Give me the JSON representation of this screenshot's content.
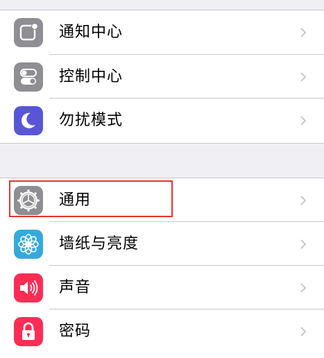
{
  "group_one": {
    "items": [
      {
        "label": "通知中心",
        "icon": "notification-center-icon",
        "icon_bg": "#8e8e93"
      },
      {
        "label": "控制中心",
        "icon": "control-center-icon",
        "icon_bg": "#8e8e93"
      },
      {
        "label": "勿扰模式",
        "icon": "moon-icon",
        "icon_bg": "#5856d6"
      }
    ]
  },
  "group_two": {
    "items": [
      {
        "label": "通用",
        "icon": "gear-icon",
        "icon_bg": "#8e8e93",
        "highlighted": true
      },
      {
        "label": "墙纸与亮度",
        "icon": "wallpaper-flower-icon",
        "icon_bg": "#34aadc"
      },
      {
        "label": "声音",
        "icon": "speaker-icon",
        "icon_bg": "#ff2d55"
      },
      {
        "label": "密码",
        "icon": "lock-icon",
        "icon_bg": "#ff2d55"
      }
    ]
  },
  "colors": {
    "background": "#efeff4",
    "separator": "#c8c7cc",
    "chevron": "#c7c7cc",
    "highlight_border": "#e0352f"
  }
}
